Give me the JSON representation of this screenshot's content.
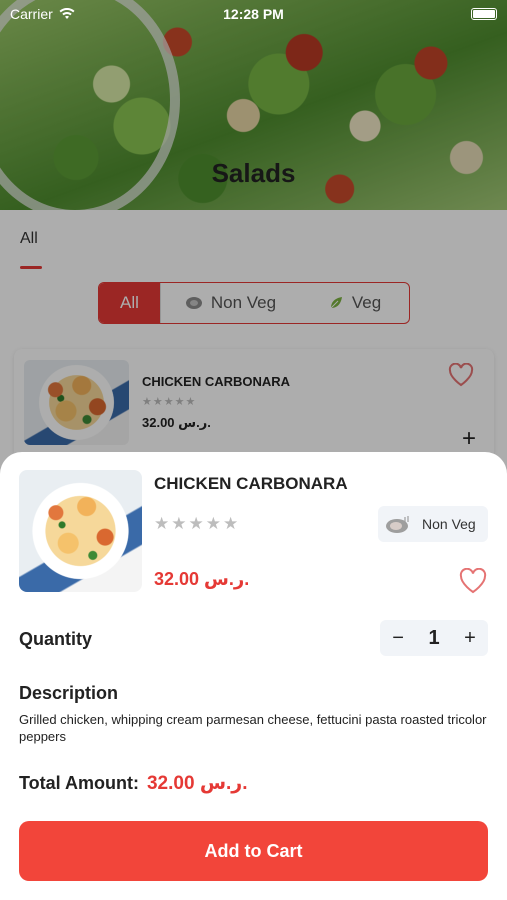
{
  "status_bar": {
    "carrier": "Carrier",
    "time": "12:28 PM"
  },
  "hero": {
    "title": "Salads"
  },
  "tabs": {
    "active": "All"
  },
  "filter": {
    "all": "All",
    "non_veg": "Non Veg",
    "veg": "Veg"
  },
  "list_item": {
    "name": "CHICKEN CARBONARA",
    "stars": "★★★★★",
    "price": "32.00 ر.س."
  },
  "sheet": {
    "name": "CHICKEN CARBONARA",
    "stars": "★★★★★",
    "badge": "Non Veg",
    "price": "32.00 ر.س.",
    "quantity_label": "Quantity",
    "quantity_value": "1",
    "minus": "−",
    "plus": "+",
    "description_title": "Description",
    "description": "Grilled chicken, whipping cream  parmesan cheese, fettucini pasta roasted tricolor peppers",
    "total_label": "Total Amount:",
    "total_value": "32.00 ر.س.",
    "cart_button": "Add to Cart"
  },
  "colors": {
    "accent": "#e53935",
    "button": "#f2453a"
  },
  "icons": [
    "wifi-icon",
    "battery-icon",
    "heart-icon",
    "plus-icon",
    "meat-icon",
    "veg-leaf-icon"
  ]
}
